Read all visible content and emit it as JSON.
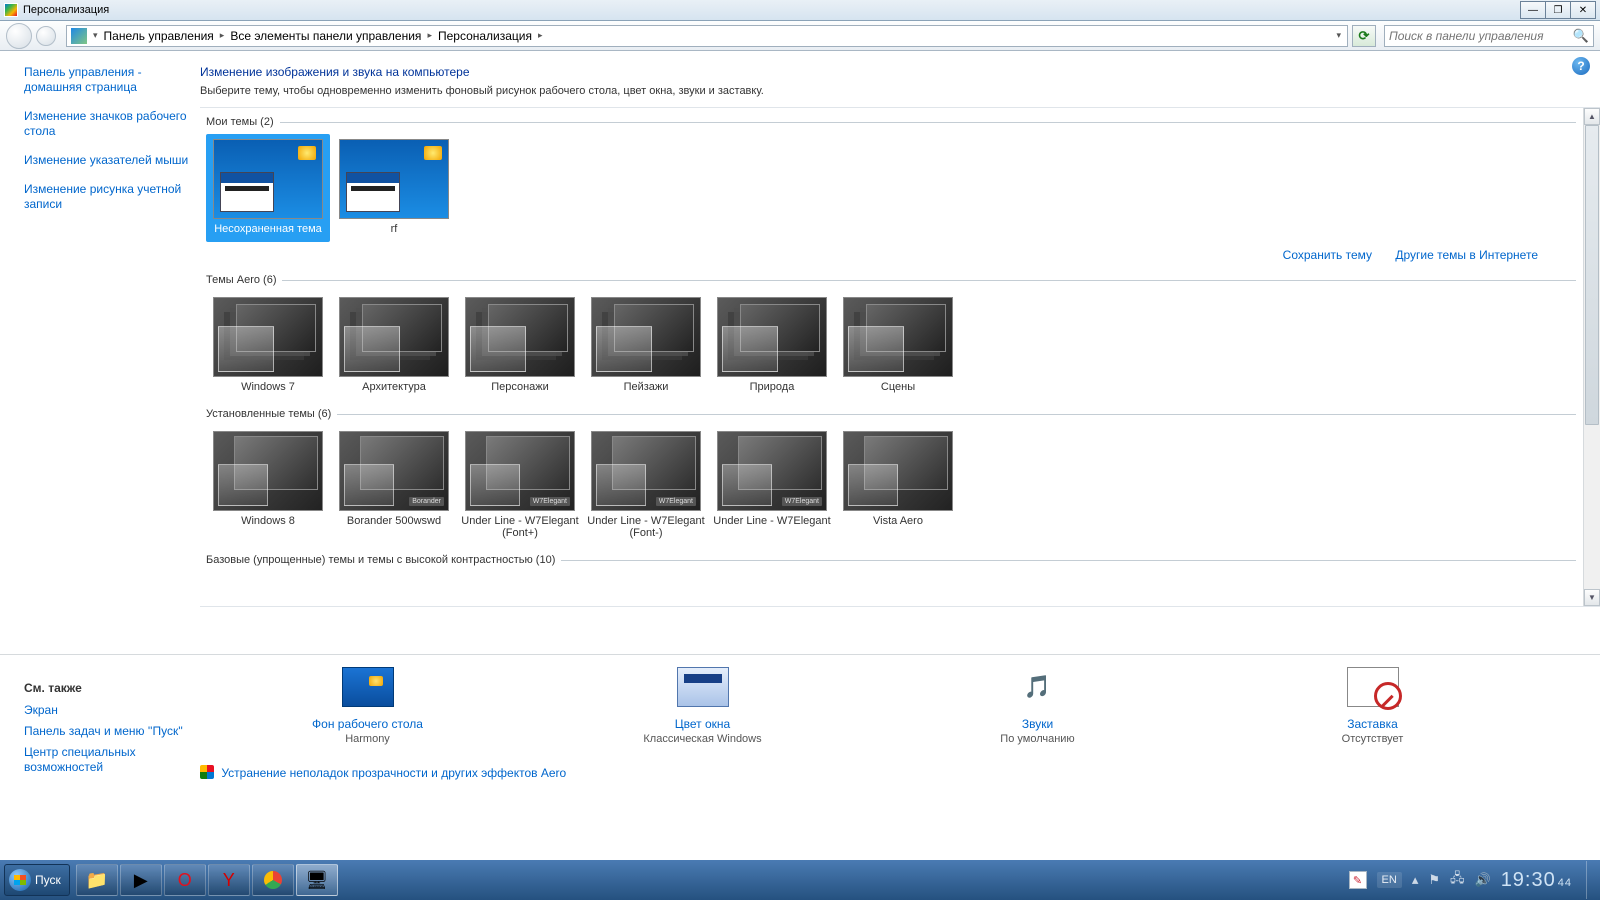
{
  "title": "Персонализация",
  "breadcrumbs": [
    "Панель управления",
    "Все элементы панели управления",
    "Персонализация"
  ],
  "search_placeholder": "Поиск в панели управления",
  "sidebar": [
    "Панель управления - домашняя страница",
    "Изменение значков рабочего стола",
    "Изменение указателей мыши",
    "Изменение рисунка учетной записи"
  ],
  "heading": "Изменение изображения и звука на компьютере",
  "subheading": "Выберите тему, чтобы одновременно изменить фоновый рисунок рабочего стола, цвет окна, звуки и заставку.",
  "groups": {
    "my": {
      "title": "Мои темы (2)",
      "items": [
        "Несохраненная тема",
        "rf"
      ]
    },
    "aero": {
      "title": "Темы Aero (6)",
      "items": [
        "Windows 7",
        "Архитектура",
        "Персонажи",
        "Пейзажи",
        "Природа",
        "Сцены"
      ]
    },
    "installed": {
      "title": "Установленные темы (6)",
      "items": [
        "Windows 8",
        "Borander 500wswd",
        "Under Line - W7Elegant (Font+)",
        "Under Line - W7Elegant (Font-)",
        "Under Line - W7Elegant",
        "Vista Aero"
      ],
      "tags": [
        "",
        "Borander",
        "W7Elegant",
        "W7Elegant",
        "W7Elegant",
        ""
      ]
    },
    "basic": {
      "title": "Базовые (упрощенные) темы и темы с высокой контрастностью (10)"
    }
  },
  "actions": {
    "save": "Сохранить тему",
    "more": "Другие темы в Интернете"
  },
  "bottom_left": {
    "heading": "См. также",
    "links": [
      "Экран",
      "Панель задач и меню ''Пуск''",
      "Центр специальных возможностей"
    ]
  },
  "settings": [
    {
      "label": "Фон рабочего стола",
      "value": "Harmony"
    },
    {
      "label": "Цвет окна",
      "value": "Классическая Windows"
    },
    {
      "label": "Звуки",
      "value": "По умолчанию"
    },
    {
      "label": "Заставка",
      "value": "Отсутствует"
    }
  ],
  "troubleshoot": "Устранение неполадок прозрачности и других эффектов Aero",
  "taskbar": {
    "start": "Пуск",
    "lang": "EN",
    "time": "19:30",
    "sec": "44"
  }
}
